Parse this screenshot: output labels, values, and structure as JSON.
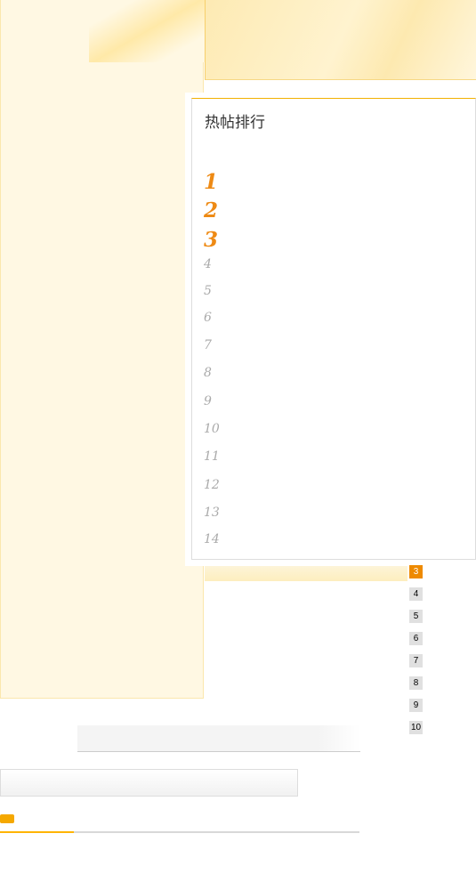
{
  "hot_posts": {
    "title": "热帖排行",
    "ranks": [
      "1",
      "2",
      "3",
      "4",
      "5",
      "6",
      "7",
      "8",
      "9",
      "10",
      "11",
      "12",
      "13",
      "14"
    ]
  },
  "pagination": {
    "pages": [
      "3",
      "4",
      "5",
      "6",
      "7",
      "8",
      "9",
      "10"
    ],
    "active": "3"
  },
  "colors": {
    "accent": "#ee8a14",
    "border": "#f2b000",
    "panel": "#fff8e3"
  }
}
